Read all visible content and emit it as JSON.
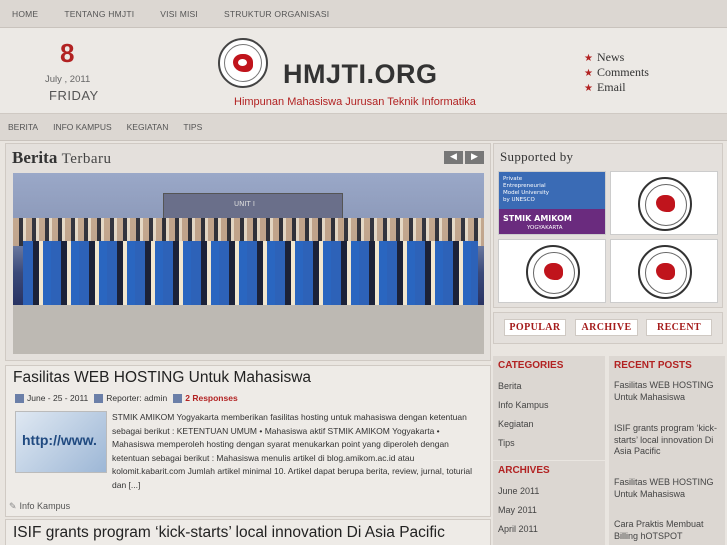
{
  "topnav": [
    "HOME",
    "TENTANG HMJTI",
    "VISI MISI",
    "STRUKTUR ORGANISASI"
  ],
  "date": {
    "day_num": "8",
    "month_year": "July , 2011",
    "weekday": "FRIDAY"
  },
  "site": {
    "title": "HMJTI.ORG",
    "subtitle": "Himpunan Mahasiswa Jurusan Teknik Informatika"
  },
  "header_links": [
    "News",
    "Comments",
    "Email"
  ],
  "subnav": [
    "BERITA",
    "INFO KAMPUS",
    "KEGIATAN",
    "TIPS"
  ],
  "featured": {
    "title_bold": "Berita",
    "title_rest": "Terbaru",
    "photo_caption": "UNIT I"
  },
  "posts": [
    {
      "title": "Fasilitas WEB HOSTING Untuk Mahasiswa",
      "date": "June - 25 - 2011",
      "reporter": "Reporter: admin",
      "responses": "2 Responses",
      "thumb_text": "http://www.",
      "excerpt": "STMIK AMIKOM Yogyakarta memberikan fasilitas hosting untuk mahasiswa dengan ketentuan sebagai berikut : KETENTUAN UMUM •    Mahasiswa aktif  STMIK AMIKOM Yogyakarta •    Mahasiswa memperoleh hosting  dengan syarat menukarkan point yang diperoleh dengan ketentuan sebagai berikut : Mahasiswa menulis artikel di blog.amikom.ac.id atau kolomit.kabarit.com Jumlah artikel minimal 10. Artikel dapat berupa berita, review, jurnal, toturial  dan [...]",
      "category": "Info Kampus"
    },
    {
      "title": "ISIF grants program ‘kick-starts’ local innovation Di Asia Pacific"
    }
  ],
  "supported": {
    "title_bold": "Supported",
    "title_rest": "by",
    "amikom": {
      "line1": "Private",
      "line2": "Entrepreneurial",
      "line3": "Model University",
      "line4": "by UNESCO",
      "name": "STMIK AMIKOM",
      "city": "YOGYAKARTA"
    }
  },
  "tabs": [
    "POPULAR",
    "ARCHIVE",
    "RECENT"
  ],
  "categories": {
    "heading": "CATEGORIES",
    "items": [
      "Berita",
      "Info Kampus",
      "Kegiatan",
      "Tips"
    ]
  },
  "archives": {
    "heading": "ARCHIVES",
    "items": [
      "June 2011",
      "May 2011",
      "April 2011"
    ]
  },
  "recent_posts": {
    "heading": "RECENT POSTS",
    "items": [
      "Fasilitas WEB HOSTING Untuk Mahasiswa",
      "ISIF grants program ‘kick-starts’ local innovation Di Asia Pacific",
      "Fasilitas WEB HOSTING Untuk Mahasiswa",
      "Cara Praktis Membuat Billing hOTSPOT"
    ]
  },
  "colors": {
    "accent": "#b22222",
    "nav_bg": "#dcd7d2",
    "page_bg": "#e9e5e0"
  }
}
